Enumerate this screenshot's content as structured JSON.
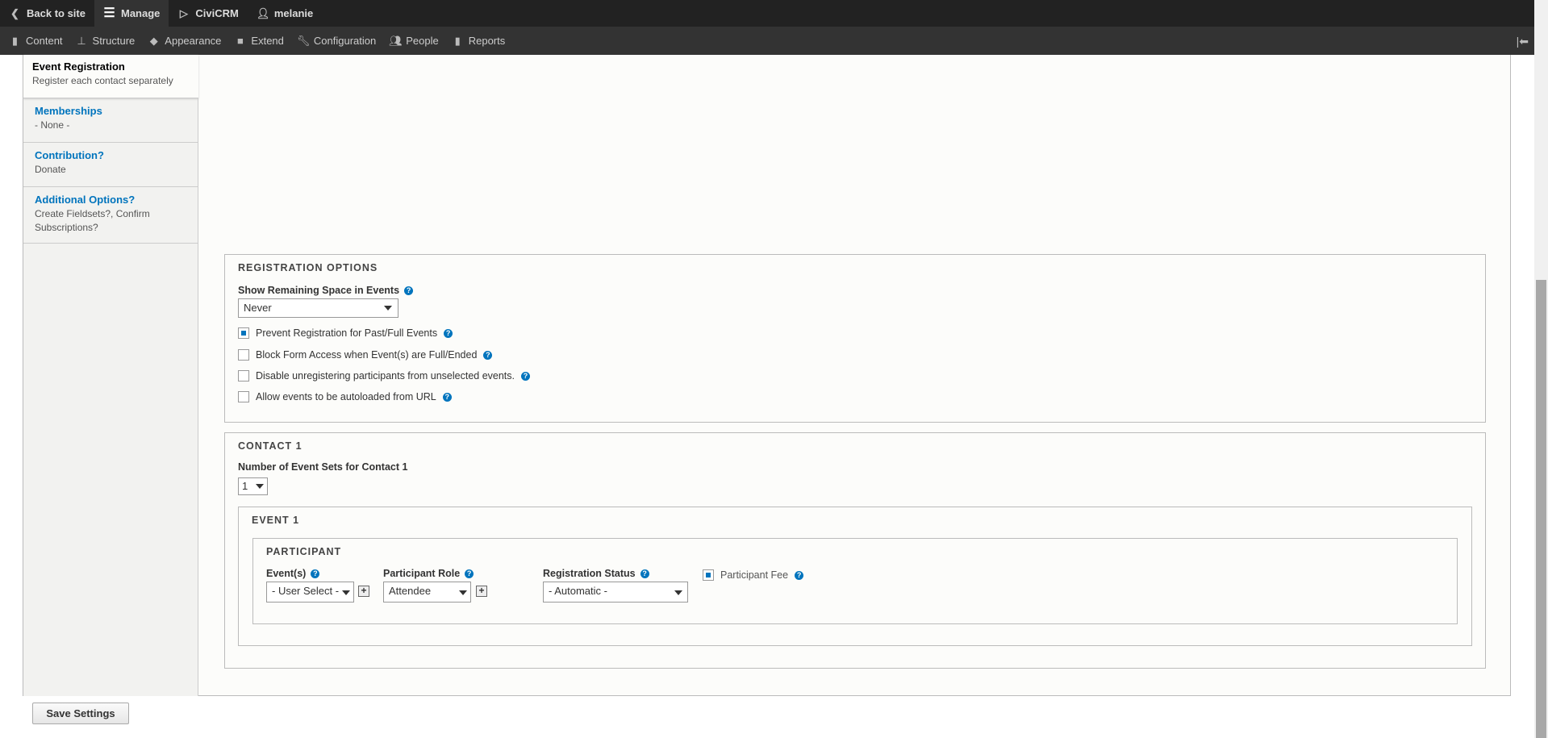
{
  "toolbar": {
    "back": "Back to site",
    "manage": "Manage",
    "civicrm": "CiviCRM",
    "user": "melanie"
  },
  "menu": [
    "Content",
    "Structure",
    "Appearance",
    "Extend",
    "Configuration",
    "People",
    "Reports"
  ],
  "tabs": [
    {
      "title": "Event Registration",
      "summary": "Register each contact separately"
    },
    {
      "title": "Memberships",
      "summary": "- None -"
    },
    {
      "title": "Contribution?",
      "summary": "Donate"
    },
    {
      "title": "Additional Options?",
      "summary": "Create Fieldsets?, Confirm Subscriptions?"
    }
  ],
  "reg": {
    "legend": "REGISTRATION OPTIONS",
    "show_label": "Show Remaining Space in Events",
    "show_value": "Never",
    "checks": [
      {
        "label": "Prevent Registration for Past/Full Events",
        "checked": true
      },
      {
        "label": "Block Form Access when Event(s) are Full/Ended",
        "checked": false
      },
      {
        "label": "Disable unregistering participants from unselected events.",
        "checked": false
      },
      {
        "label": "Allow events to be autoloaded from URL",
        "checked": false
      }
    ]
  },
  "contact": {
    "legend": "CONTACT 1",
    "sets_label": "Number of Event Sets for Contact 1",
    "sets_value": "1",
    "event": {
      "legend": "EVENT 1",
      "participant": {
        "legend": "PARTICIPANT",
        "events_label": "Event(s)",
        "events_value": "- User Select -",
        "role_label": "Participant Role",
        "role_value": "Attendee",
        "status_label": "Registration Status",
        "status_value": "- Automatic -",
        "fee_label": "Participant Fee",
        "fee_checked": true
      }
    }
  },
  "save": "Save Settings",
  "colors": {
    "accent": "#0074bd",
    "toolbar": "#222222"
  }
}
